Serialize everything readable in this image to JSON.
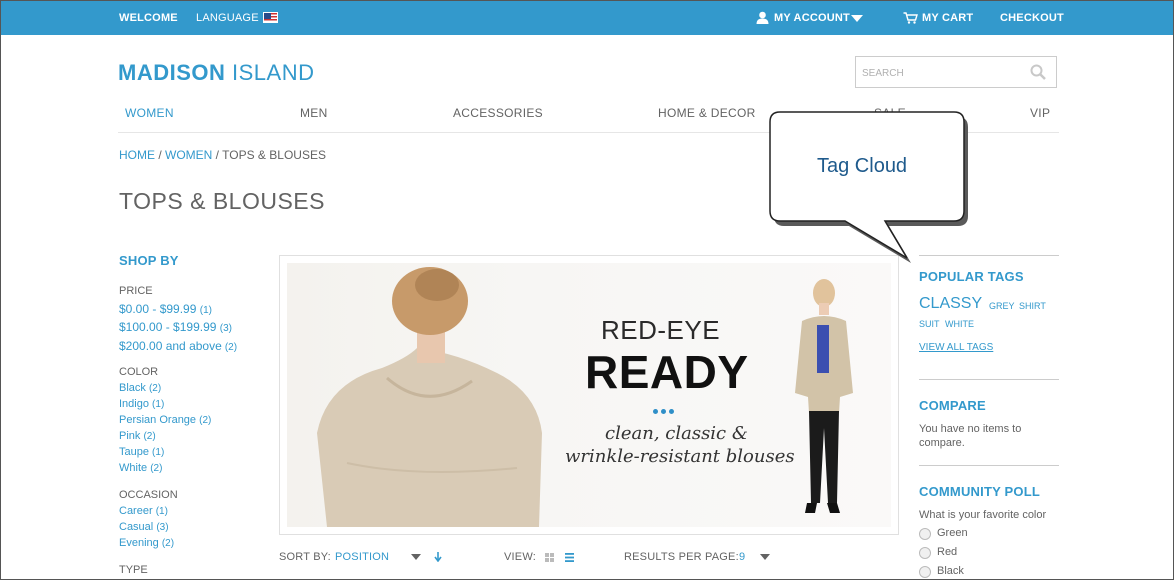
{
  "header": {
    "welcome": "WELCOME",
    "language": "LANGUAGE",
    "my_account": "MY ACCOUNT",
    "my_cart": "MY CART",
    "checkout": "CHECKOUT"
  },
  "logo": {
    "bold": "MADISON",
    "light": "ISLAND"
  },
  "search": {
    "placeholder": "SEARCH"
  },
  "nav": [
    "WOMEN",
    "MEN",
    "ACCESSORIES",
    "HOME & DECOR",
    "SALE",
    "VIP"
  ],
  "breadcrumb": {
    "home": "HOME",
    "women": "WOMEN",
    "current": "TOPS & BLOUSES",
    "sep": " / "
  },
  "page_title": "TOPS & BLOUSES",
  "sidebar": {
    "heading": "SHOP BY",
    "price": {
      "label": "PRICE",
      "items": [
        {
          "label": "$0.00 - $99.99",
          "count": "(1)"
        },
        {
          "label": "$100.00 - $199.99",
          "count": "(3)"
        },
        {
          "label": "$200.00 and above",
          "count": "(2)"
        }
      ]
    },
    "color": {
      "label": "COLOR",
      "items": [
        {
          "label": "Black",
          "count": "(2)"
        },
        {
          "label": "Indigo",
          "count": "(1)"
        },
        {
          "label": "Persian Orange",
          "count": "(2)"
        },
        {
          "label": "Pink",
          "count": "(2)"
        },
        {
          "label": "Taupe",
          "count": "(1)"
        },
        {
          "label": "White",
          "count": "(2)"
        }
      ]
    },
    "occasion": {
      "label": "OCCASION",
      "items": [
        {
          "label": "Career",
          "count": "(1)"
        },
        {
          "label": "Casual",
          "count": "(3)"
        },
        {
          "label": "Evening",
          "count": "(2)"
        }
      ]
    },
    "type": {
      "label": "TYPE"
    }
  },
  "banner": {
    "line1": "RED-EYE",
    "line2": "READY",
    "tagline1": "clean, classic &",
    "tagline2": "wrinkle-resistant blouses"
  },
  "toolbar": {
    "sort_by": "SORT BY:",
    "sort_value": "POSITION",
    "view": "VIEW:",
    "results_per_page": "RESULTS PER PAGE:",
    "per_page_value": "9"
  },
  "right": {
    "popular_tags": "POPULAR TAGS",
    "tags": [
      "CLASSY",
      "GREY",
      "SHIRT",
      "SUIT",
      "WHITE"
    ],
    "view_all_tags": "VIEW ALL TAGS",
    "compare": "COMPARE",
    "compare_text": "You have no items to compare.",
    "poll": "COMMUNITY POLL",
    "poll_question": "What is your favorite color",
    "poll_options": [
      "Green",
      "Red",
      "Black"
    ]
  },
  "callout": {
    "text": "Tag Cloud"
  },
  "colors": {
    "accent": "#3399cc",
    "text": "#636363"
  },
  "icons": [
    "user-icon",
    "cart-icon",
    "search-icon",
    "flag-icon",
    "chevron-down-icon",
    "grid-view-icon",
    "list-view-icon",
    "sort-arrow-icon"
  ]
}
